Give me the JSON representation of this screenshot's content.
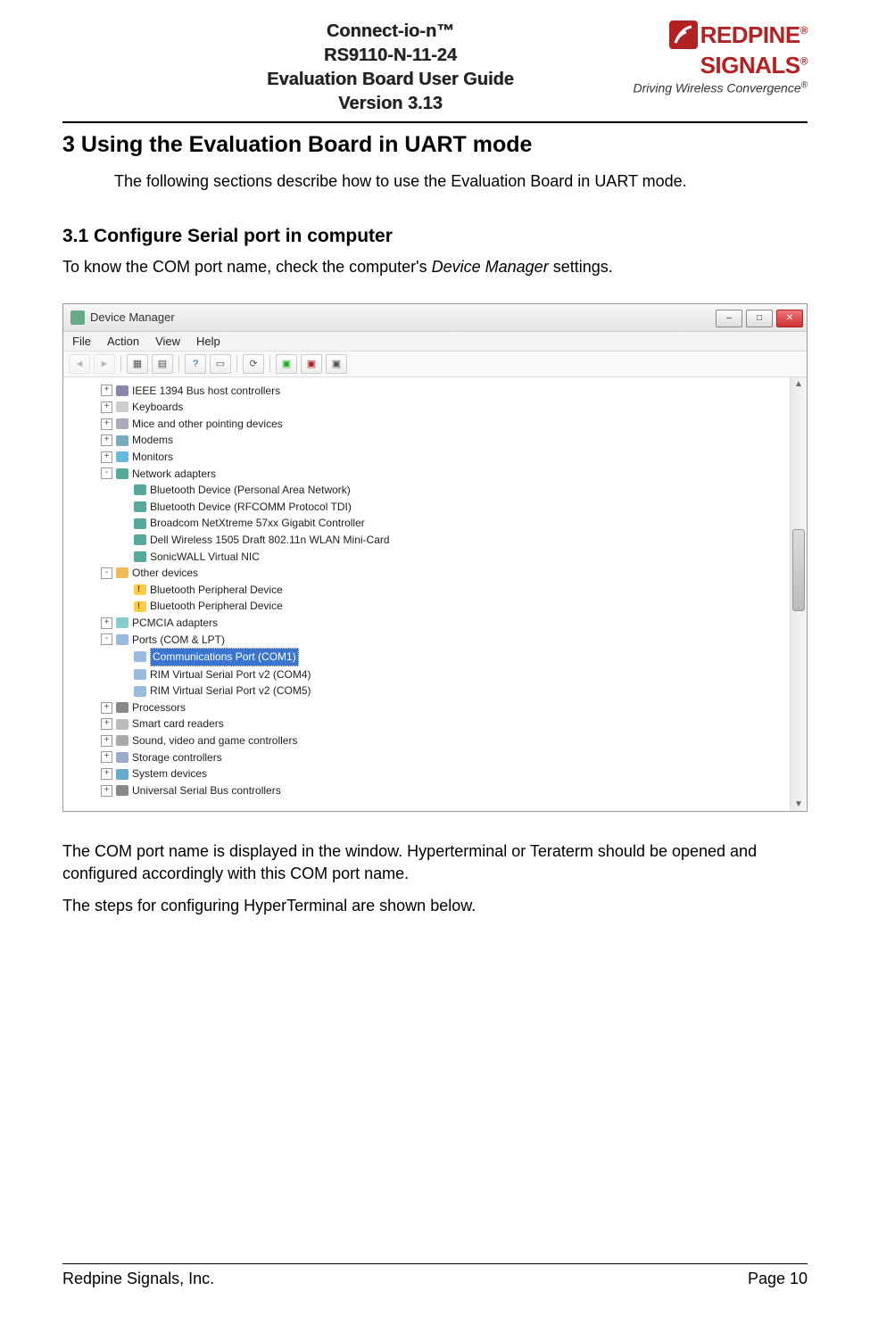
{
  "header": {
    "line1": "Connect-io-n™",
    "line2": "RS9110-N-11-24",
    "line3": "Evaluation Board User Guide",
    "line4": "Version 3.13",
    "logo_top": "REDPINE",
    "logo_bottom": "SIGNALS",
    "logo_reg": "®",
    "tagline": "Driving Wireless Convergence",
    "tagline_reg": "®"
  },
  "section": {
    "h1": "3  Using the Evaluation Board in UART mode",
    "intro": "The following sections describe how to use the Evaluation Board in UART mode.",
    "h2": "3.1  Configure Serial port in computer",
    "p1_pre": "To know the COM port name, check the computer's ",
    "p1_em": "Device Manager",
    "p1_post": " settings.",
    "p2": "The COM port name is displayed in the window. Hyperterminal or Teraterm should be opened and configured accordingly with this COM port name.",
    "p3": "The steps for configuring HyperTerminal are shown below."
  },
  "device_manager": {
    "title": "Device Manager",
    "menus": [
      "File",
      "Action",
      "View",
      "Help"
    ],
    "tree": [
      {
        "depth": 1,
        "exp": "+",
        "icon": "ic-generic",
        "label": "IEEE 1394 Bus host controllers"
      },
      {
        "depth": 1,
        "exp": "+",
        "icon": "ic-kb",
        "label": "Keyboards"
      },
      {
        "depth": 1,
        "exp": "+",
        "icon": "ic-mouse",
        "label": "Mice and other pointing devices"
      },
      {
        "depth": 1,
        "exp": "+",
        "icon": "ic-modem",
        "label": "Modems"
      },
      {
        "depth": 1,
        "exp": "+",
        "icon": "ic-monitor",
        "label": "Monitors"
      },
      {
        "depth": 1,
        "exp": "-",
        "icon": "ic-net",
        "label": "Network adapters"
      },
      {
        "depth": 2,
        "exp": "",
        "icon": "ic-net",
        "label": "Bluetooth Device (Personal Area Network)"
      },
      {
        "depth": 2,
        "exp": "",
        "icon": "ic-net",
        "label": "Bluetooth Device (RFCOMM Protocol TDI)"
      },
      {
        "depth": 2,
        "exp": "",
        "icon": "ic-net",
        "label": "Broadcom NetXtreme 57xx Gigabit Controller"
      },
      {
        "depth": 2,
        "exp": "",
        "icon": "ic-net",
        "label": "Dell Wireless 1505 Draft 802.11n WLAN Mini-Card"
      },
      {
        "depth": 2,
        "exp": "",
        "icon": "ic-net",
        "label": "SonicWALL Virtual NIC"
      },
      {
        "depth": 1,
        "exp": "-",
        "icon": "ic-other",
        "label": "Other devices"
      },
      {
        "depth": 2,
        "exp": "",
        "icon": "ic-warn",
        "label": "Bluetooth Peripheral Device"
      },
      {
        "depth": 2,
        "exp": "",
        "icon": "ic-warn",
        "label": "Bluetooth Peripheral Device"
      },
      {
        "depth": 1,
        "exp": "+",
        "icon": "ic-pcmcia",
        "label": "PCMCIA adapters"
      },
      {
        "depth": 1,
        "exp": "-",
        "icon": "ic-port",
        "label": "Ports (COM & LPT)"
      },
      {
        "depth": 2,
        "exp": "",
        "icon": "ic-port",
        "label": "Communications Port (COM1)",
        "selected": true
      },
      {
        "depth": 2,
        "exp": "",
        "icon": "ic-port",
        "label": "RIM Virtual Serial Port v2 (COM4)"
      },
      {
        "depth": 2,
        "exp": "",
        "icon": "ic-port",
        "label": "RIM Virtual Serial Port v2 (COM5)"
      },
      {
        "depth": 1,
        "exp": "+",
        "icon": "ic-cpu",
        "label": "Processors"
      },
      {
        "depth": 1,
        "exp": "+",
        "icon": "ic-smart",
        "label": "Smart card readers"
      },
      {
        "depth": 1,
        "exp": "+",
        "icon": "ic-sound",
        "label": "Sound, video and game controllers"
      },
      {
        "depth": 1,
        "exp": "+",
        "icon": "ic-storage",
        "label": "Storage controllers"
      },
      {
        "depth": 1,
        "exp": "+",
        "icon": "ic-sys",
        "label": "System devices"
      },
      {
        "depth": 1,
        "exp": "+",
        "icon": "ic-usb",
        "label": "Universal Serial Bus controllers"
      }
    ]
  },
  "footer": {
    "company": "Redpine Signals, Inc.",
    "page": "Page 10"
  }
}
